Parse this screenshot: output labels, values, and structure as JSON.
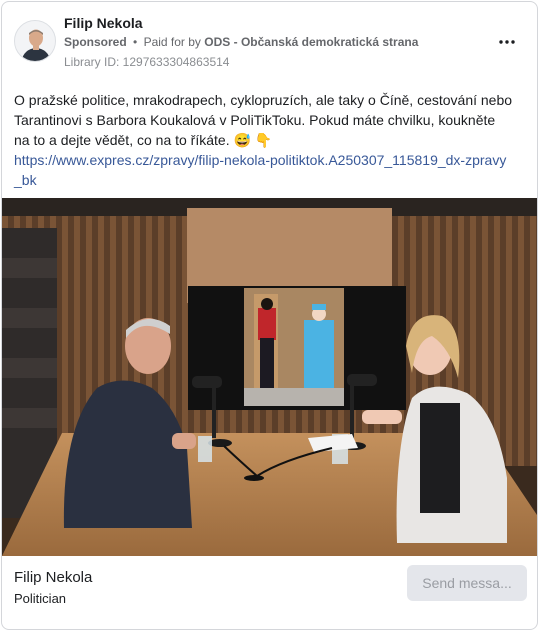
{
  "header": {
    "page_name": "Filip Nekola",
    "sponsored_label": "Sponsored",
    "separator": "•",
    "paid_for_prefix": "Paid for by",
    "payer": "ODS - Občanská demokratická strana",
    "library_id": "Library ID: 1297633304863514",
    "more_icon": "more-horizontal-icon"
  },
  "post": {
    "text": "O pražské politice, mrakodrapech, cyklopruzích, ale taky o Číně, cestování nebo Tarantinovi s Barbora Koukalová v PoliTikToku. Pokud máte chvilku, koukněte na to a dejte vědět, co na to říkáte. 😅 👇",
    "link": "https://www.expres.cz/zpravy/filip-nekola-politiktok.A250307_115819_dx-zpravy_bk"
  },
  "footer": {
    "name": "Filip Nekola",
    "subtitle": "Politician",
    "send_button_label": "Send messa..."
  },
  "colors": {
    "link": "#385898",
    "meta": "#65676b",
    "button_bg": "#e4e6eb"
  }
}
